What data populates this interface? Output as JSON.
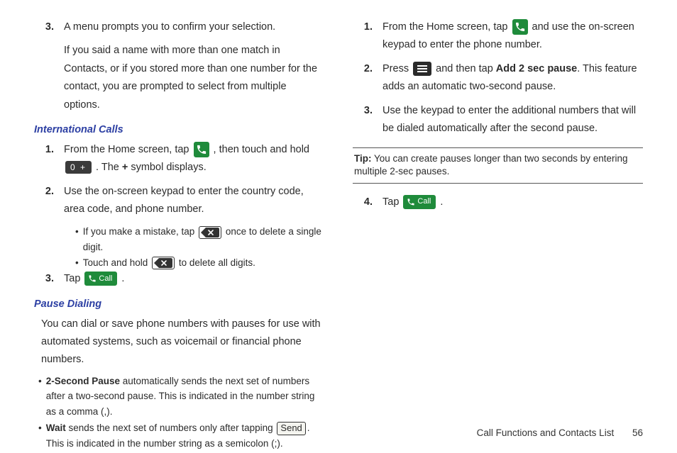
{
  "left": {
    "step3a": "A menu prompts you to confirm your selection.",
    "step3b": "If you said a name with more than one match in Contacts, or if you stored more than one number for the contact, you are prompted to select from multiple options.",
    "intl_title": "International Calls",
    "intl_1_pre": "From the Home screen, tap ",
    "intl_1_mid": " , then touch and hold ",
    "intl_1_post_a": ". The ",
    "intl_1_plus": "+",
    "intl_1_post_b": " symbol displays.",
    "zero_label": "0  +",
    "intl_2": "Use the on-screen keypad to enter the country code, area code, and phone number.",
    "intl_b1_pre": "If you make a mistake, tap ",
    "intl_b1_post": " once to delete a single digit.",
    "intl_b2_pre": "Touch and hold ",
    "intl_b2_post": " to delete all digits.",
    "intl_3_pre": "Tap ",
    "intl_3_post": ".",
    "call_label": "Call",
    "pause_title": "Pause Dialing",
    "pause_intro": "You can dial or save phone numbers with pauses for use with automated systems, such as voicemail or financial phone numbers.",
    "pb1_bold": "2-Second Pause",
    "pb1_rest": " automatically sends the next set of numbers after a two-second pause. This is indicated in the number string as a comma (,).",
    "pb2_bold": "Wait",
    "pb2_mid_a": " sends the next set of numbers only after tapping ",
    "send_label": "Send",
    "pb2_mid_b": ". This is indicated in the number string as a semicolon (;)."
  },
  "right": {
    "s1_pre": "From the Home screen, tap ",
    "s1_post": " and use the on-screen keypad to enter the phone number.",
    "s2_pre": "Press ",
    "s2_mid": " and then tap ",
    "s2_bold": "Add 2 sec pause",
    "s2_post": ". This feature adds an automatic two-second pause.",
    "s3": "Use the keypad to enter the additional numbers that will be dialed automatically after the second pause.",
    "tip_label": "Tip:",
    "tip_text": " You can create pauses longer than two seconds by entering multiple 2-sec pauses.",
    "s4_pre": "Tap ",
    "s4_post": ".",
    "call_label": "Call"
  },
  "footer": {
    "title": "Call Functions and Contacts List",
    "page": "56"
  },
  "numbers": {
    "n1": "1.",
    "n2": "2.",
    "n3": "3.",
    "n4": "4."
  }
}
